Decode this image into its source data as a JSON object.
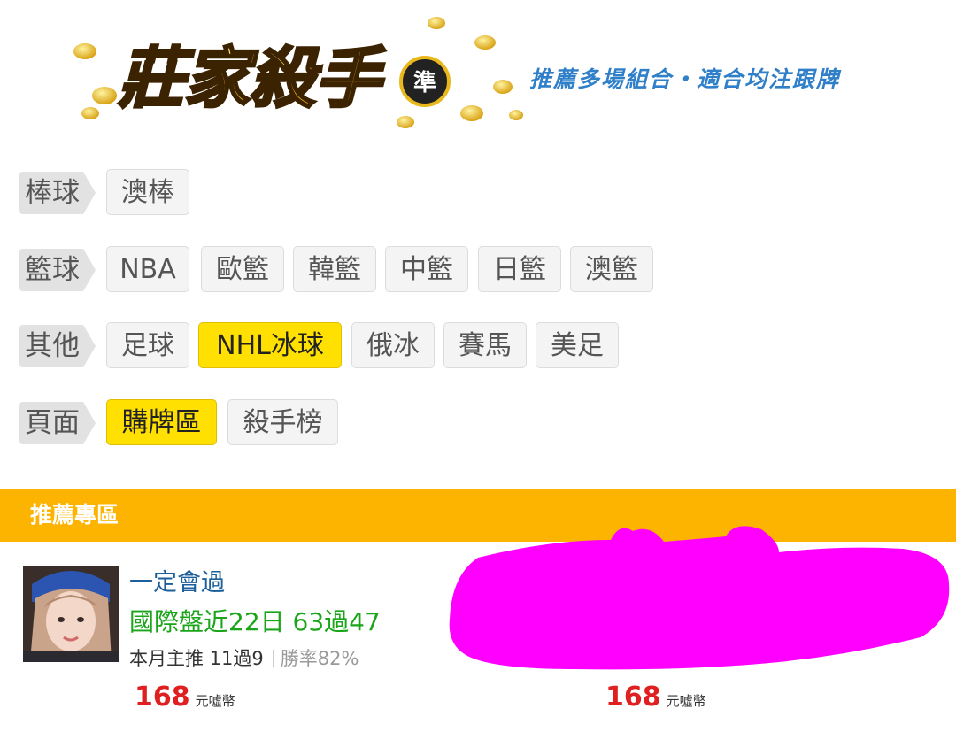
{
  "header": {
    "logo_text": "莊家殺手",
    "logo_badge": "準",
    "slogan": "推薦多場組合・適合均注跟牌"
  },
  "filters": [
    {
      "category": "棒球",
      "tags": [
        {
          "label": "澳棒",
          "active": false
        }
      ]
    },
    {
      "category": "籃球",
      "tags": [
        {
          "label": "NBA",
          "active": false
        },
        {
          "label": "歐籃",
          "active": false
        },
        {
          "label": "韓籃",
          "active": false
        },
        {
          "label": "中籃",
          "active": false
        },
        {
          "label": "日籃",
          "active": false
        },
        {
          "label": "澳籃",
          "active": false
        }
      ]
    },
    {
      "category": "其他",
      "tags": [
        {
          "label": "足球",
          "active": false
        },
        {
          "label": "NHL冰球",
          "active": true
        },
        {
          "label": "俄冰",
          "active": false
        },
        {
          "label": "賽馬",
          "active": false
        },
        {
          "label": "美足",
          "active": false
        }
      ]
    },
    {
      "category": "頁面",
      "tags": [
        {
          "label": "購牌區",
          "active": true
        },
        {
          "label": "殺手榜",
          "active": false
        }
      ]
    }
  ],
  "recommend": {
    "title": "推薦專區",
    "cards": [
      {
        "name": "一定會過",
        "record": "國際盤近22日 63過47",
        "monthly": "本月主推 11過9",
        "win_rate": "勝率82%",
        "price": "168",
        "unit": "元噓幣"
      },
      {
        "price": "168",
        "unit": "元噓幣"
      }
    ]
  },
  "colors": {
    "accent_yellow": "#ffe000",
    "section_bar": "#fdb400",
    "slogan_blue": "#2f7fc9",
    "record_green": "#1aa51a",
    "price_red": "#e02020",
    "redaction_magenta": "#ff00ff"
  }
}
